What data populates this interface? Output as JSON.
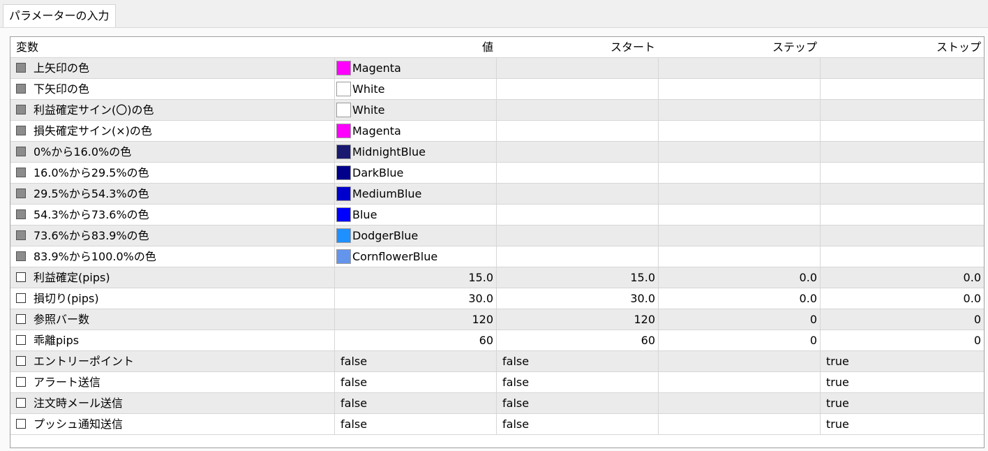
{
  "tabs": [
    {
      "label": "パラメーターの入力"
    }
  ],
  "columns": [
    "変数",
    "値",
    "スタート",
    "ステップ",
    "ストップ"
  ],
  "color_rows": [
    {
      "name": "上矢印の色",
      "color_name": "Magenta",
      "hex": "#FF00FF"
    },
    {
      "name": "下矢印の色",
      "color_name": "White",
      "hex": "#FFFFFF"
    },
    {
      "name": "利益確定サイン(〇)の色",
      "color_name": "White",
      "hex": "#FFFFFF"
    },
    {
      "name": "損失確定サイン(×)の色",
      "color_name": "Magenta",
      "hex": "#FF00FF"
    },
    {
      "name": "0%から16.0%の色",
      "color_name": "MidnightBlue",
      "hex": "#191970"
    },
    {
      "name": "16.0%から29.5%の色",
      "color_name": "DarkBlue",
      "hex": "#00008B"
    },
    {
      "name": "29.5%から54.3%の色",
      "color_name": "MediumBlue",
      "hex": "#0000CD"
    },
    {
      "name": "54.3%から73.6%の色",
      "color_name": "Blue",
      "hex": "#0000FF"
    },
    {
      "name": "73.6%から83.9%の色",
      "color_name": "DodgerBlue",
      "hex": "#1E90FF"
    },
    {
      "name": "83.9%から100.0%の色",
      "color_name": "CornflowerBlue",
      "hex": "#6495ED"
    }
  ],
  "numeric_rows": [
    {
      "name": "利益確定(pips)",
      "value": "15.0",
      "start": "15.0",
      "step": "0.0",
      "stop": "0.0"
    },
    {
      "name": "損切り(pips)",
      "value": "30.0",
      "start": "30.0",
      "step": "0.0",
      "stop": "0.0"
    },
    {
      "name": "参照バー数",
      "value": "120",
      "start": "120",
      "step": "0",
      "stop": "0"
    },
    {
      "name": "乖離pips",
      "value": "60",
      "start": "60",
      "step": "0",
      "stop": "0"
    }
  ],
  "bool_rows": [
    {
      "name": "エントリーポイント",
      "value": "false",
      "start": "false",
      "step": "",
      "stop": "true"
    },
    {
      "name": "アラート送信",
      "value": "false",
      "start": "false",
      "step": "",
      "stop": "true"
    },
    {
      "name": "注文時メール送信",
      "value": "false",
      "start": "false",
      "step": "",
      "stop": "true"
    },
    {
      "name": "プッシュ通知送信",
      "value": "false",
      "start": "false",
      "step": "",
      "stop": "true"
    }
  ]
}
